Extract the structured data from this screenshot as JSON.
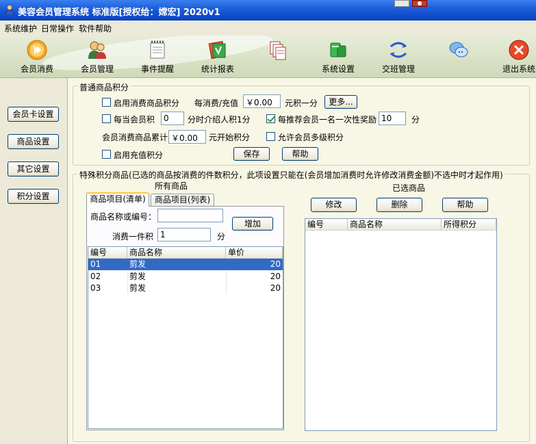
{
  "window": {
    "title": "美容会员管理系统 标准版[授权给：嫦宏] 2020v1"
  },
  "menu": [
    "系统维护",
    "日常操作",
    "软件帮助"
  ],
  "toolbar": [
    {
      "label": "会员消费",
      "icon": "play-circle-icon"
    },
    {
      "label": "会员管理",
      "icon": "members-icon"
    },
    {
      "label": "事件提醒",
      "icon": "notepad-icon"
    },
    {
      "label": "统计报表",
      "icon": "report-icon"
    },
    {
      "label": "",
      "icon": "documents-icon"
    },
    {
      "label": "系统设置",
      "icon": "settings-icon"
    },
    {
      "label": "交班管理",
      "icon": "handover-icon"
    },
    {
      "label": "",
      "icon": "chat-icon"
    },
    {
      "label": "退出系统",
      "icon": "exit-icon"
    }
  ],
  "nav": [
    "会员卡设置",
    "商品设置",
    "其它设置",
    "积分设置"
  ],
  "general": {
    "title": "普通商品积分",
    "enable_consume_points": "启用消费商品积分",
    "per_spend_label": "每消费/充值",
    "per_spend_value": "￥0.00",
    "per_spend_unit": "元积一分",
    "more_button": "更多...",
    "per_member_label": "每当会员积",
    "per_member_value": "0",
    "per_member_unit": "分时介绍人积1分",
    "recommend_label": "每推荐会员一名一次性奖励",
    "recommend_value": "10",
    "recommend_unit": "分",
    "cumulative_label": "会员消费商品累计",
    "cumulative_value": "￥0.00",
    "cumulative_unit": "元开始积分",
    "multi_level": "允许会员多级积分",
    "enable_recharge": "启用充值积分",
    "save_button": "保存",
    "help_button": "帮助"
  },
  "special": {
    "title": "特殊积分商品(已选的商品按消费的件数积分，此项设置只能在(会员增加消费时允许修改消费金额)不选中时才起作用)",
    "all_goods": "所有商品",
    "selected_goods": "已选商品",
    "tabs": [
      "商品项目(清单)",
      "商品项目(列表)"
    ],
    "name_or_code_label": "商品名称或编号：",
    "add_button": "增加",
    "per_item_label": "消费一件积",
    "per_item_value": "1",
    "per_item_unit": "分",
    "goods_columns": [
      "编号",
      "商品名称",
      "单价"
    ],
    "goods_rows": [
      {
        "code": "01",
        "name": "剪发",
        "price": "20"
      },
      {
        "code": "02",
        "name": "剪发",
        "price": "20"
      },
      {
        "code": "03",
        "name": "剪发",
        "price": "20"
      }
    ],
    "edit_button": "修改",
    "delete_button": "删除",
    "help_button": "帮助",
    "selected_columns": [
      "编号",
      "商品名称",
      "所得积分"
    ]
  },
  "colors": {
    "title_bar": "#0a46c8",
    "selection": "#316ac5",
    "content_bg": "#f8f6e4"
  }
}
